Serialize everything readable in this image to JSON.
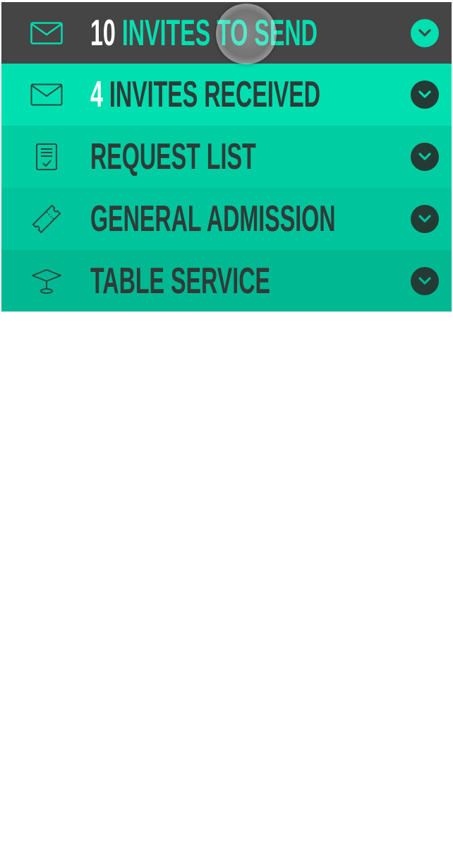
{
  "menu": {
    "items": [
      {
        "count": "10",
        "text": "INVITES TO SEND",
        "icon": "envelope-icon"
      },
      {
        "count": "4",
        "text": "INVITES RECEIVED",
        "icon": "envelope-icon"
      },
      {
        "count": "",
        "text": "REQUEST LIST",
        "icon": "clipboard-icon"
      },
      {
        "count": "",
        "text": "GENERAL ADMISSION",
        "icon": "ticket-icon"
      },
      {
        "count": "",
        "text": "TABLE SERVICE",
        "icon": "cocktail-table-icon"
      }
    ]
  },
  "colors": {
    "dark_row": "#454545",
    "accent": "#00dfb0",
    "chevron_dark": "#243b35"
  }
}
